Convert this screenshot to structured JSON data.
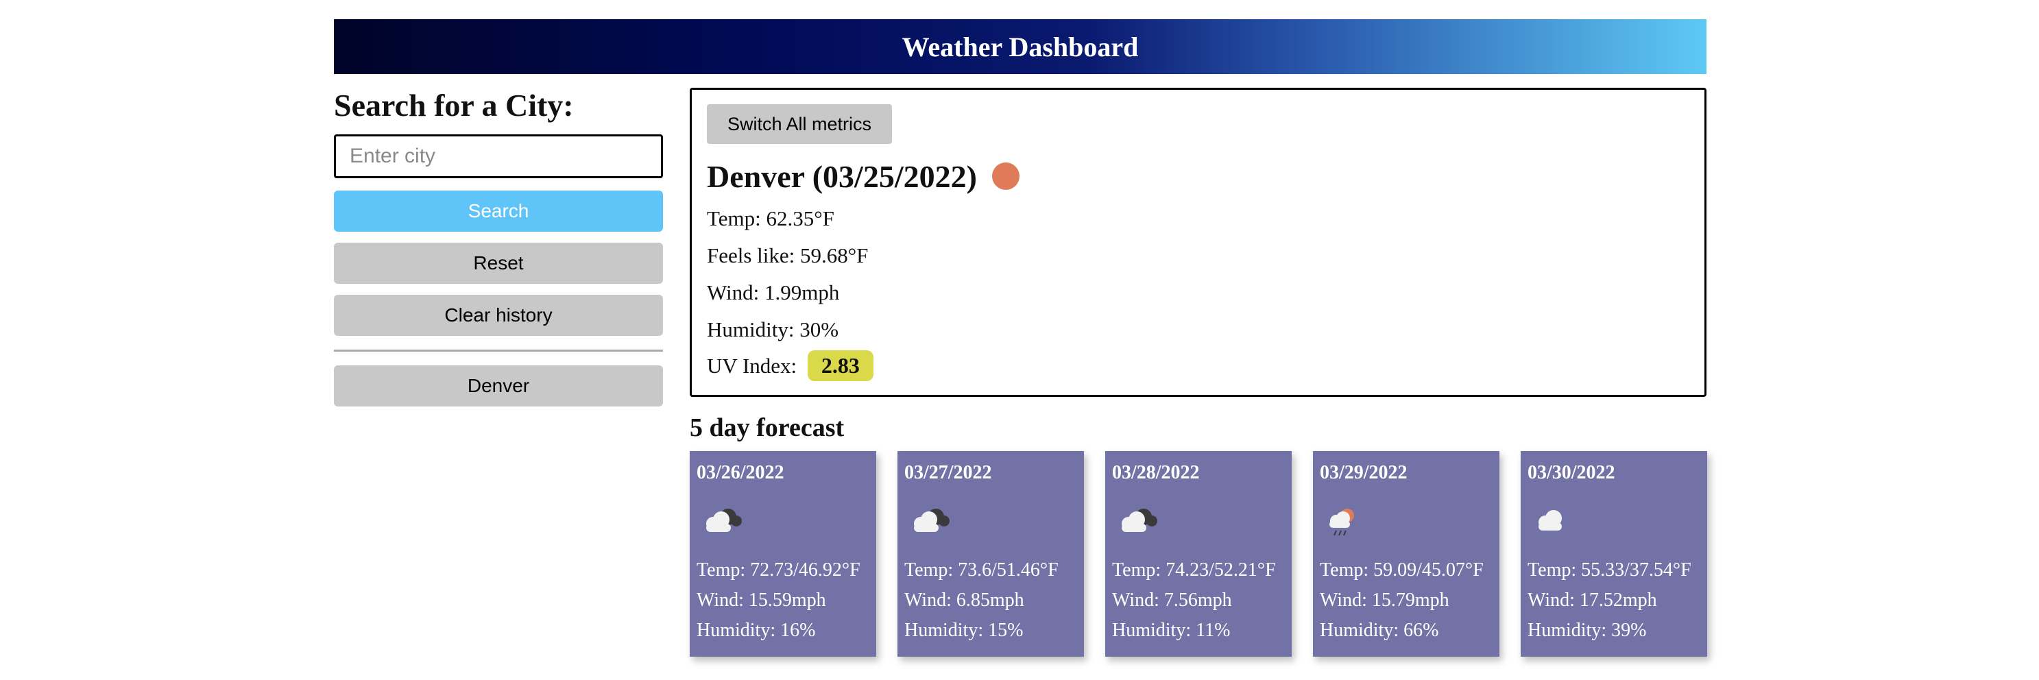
{
  "header": {
    "title": "Weather Dashboard"
  },
  "sidebar": {
    "search_heading": "Search for a City:",
    "city_placeholder": "Enter city",
    "search_label": "Search",
    "reset_label": "Reset",
    "clear_label": "Clear history",
    "history": [
      "Denver"
    ]
  },
  "current": {
    "switch_label": "Switch All metrics",
    "city_title": "Denver (03/25/2022)",
    "temp": "Temp: 62.35°F",
    "feels_like": "Feels like: 59.68°F",
    "wind": "Wind: 1.99mph",
    "humidity": "Humidity: 30%",
    "uv_label": "UV Index:",
    "uv_value": "2.83",
    "status_color": "#e07b5a",
    "uv_color": "#d9d94a"
  },
  "forecast": {
    "title": "5 day forecast",
    "card_color": "#7272a6",
    "days": [
      {
        "date": "03/26/2022",
        "icon": "cloudy-icon",
        "temp": "Temp: 72.73/46.92°F",
        "wind": "Wind: 15.59mph",
        "humidity": "Humidity: 16%"
      },
      {
        "date": "03/27/2022",
        "icon": "cloudy-icon",
        "temp": "Temp: 73.6/51.46°F",
        "wind": "Wind: 6.85mph",
        "humidity": "Humidity: 15%"
      },
      {
        "date": "03/28/2022",
        "icon": "cloudy-icon",
        "temp": "Temp: 74.23/52.21°F",
        "wind": "Wind: 7.56mph",
        "humidity": "Humidity: 11%"
      },
      {
        "date": "03/29/2022",
        "icon": "rain-sun-icon",
        "temp": "Temp: 59.09/45.07°F",
        "wind": "Wind: 15.79mph",
        "humidity": "Humidity: 66%"
      },
      {
        "date": "03/30/2022",
        "icon": "cloud-icon",
        "temp": "Temp: 55.33/37.54°F",
        "wind": "Wind: 17.52mph",
        "humidity": "Humidity: 39%"
      }
    ]
  }
}
